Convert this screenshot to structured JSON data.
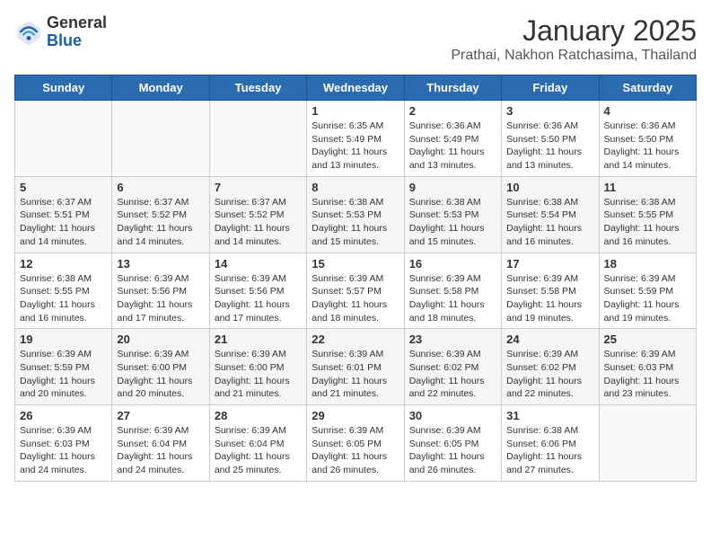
{
  "header": {
    "logo_line1": "General",
    "logo_line2": "Blue",
    "title": "January 2025",
    "subtitle": "Prathai, Nakhon Ratchasima, Thailand"
  },
  "days_of_week": [
    "Sunday",
    "Monday",
    "Tuesday",
    "Wednesday",
    "Thursday",
    "Friday",
    "Saturday"
  ],
  "weeks": [
    [
      {
        "day": "",
        "sunrise": "",
        "sunset": "",
        "daylight": ""
      },
      {
        "day": "",
        "sunrise": "",
        "sunset": "",
        "daylight": ""
      },
      {
        "day": "",
        "sunrise": "",
        "sunset": "",
        "daylight": ""
      },
      {
        "day": "1",
        "sunrise": "Sunrise: 6:35 AM",
        "sunset": "Sunset: 5:49 PM",
        "daylight": "Daylight: 11 hours and 13 minutes."
      },
      {
        "day": "2",
        "sunrise": "Sunrise: 6:36 AM",
        "sunset": "Sunset: 5:49 PM",
        "daylight": "Daylight: 11 hours and 13 minutes."
      },
      {
        "day": "3",
        "sunrise": "Sunrise: 6:36 AM",
        "sunset": "Sunset: 5:50 PM",
        "daylight": "Daylight: 11 hours and 13 minutes."
      },
      {
        "day": "4",
        "sunrise": "Sunrise: 6:36 AM",
        "sunset": "Sunset: 5:50 PM",
        "daylight": "Daylight: 11 hours and 14 minutes."
      }
    ],
    [
      {
        "day": "5",
        "sunrise": "Sunrise: 6:37 AM",
        "sunset": "Sunset: 5:51 PM",
        "daylight": "Daylight: 11 hours and 14 minutes."
      },
      {
        "day": "6",
        "sunrise": "Sunrise: 6:37 AM",
        "sunset": "Sunset: 5:52 PM",
        "daylight": "Daylight: 11 hours and 14 minutes."
      },
      {
        "day": "7",
        "sunrise": "Sunrise: 6:37 AM",
        "sunset": "Sunset: 5:52 PM",
        "daylight": "Daylight: 11 hours and 14 minutes."
      },
      {
        "day": "8",
        "sunrise": "Sunrise: 6:38 AM",
        "sunset": "Sunset: 5:53 PM",
        "daylight": "Daylight: 11 hours and 15 minutes."
      },
      {
        "day": "9",
        "sunrise": "Sunrise: 6:38 AM",
        "sunset": "Sunset: 5:53 PM",
        "daylight": "Daylight: 11 hours and 15 minutes."
      },
      {
        "day": "10",
        "sunrise": "Sunrise: 6:38 AM",
        "sunset": "Sunset: 5:54 PM",
        "daylight": "Daylight: 11 hours and 16 minutes."
      },
      {
        "day": "11",
        "sunrise": "Sunrise: 6:38 AM",
        "sunset": "Sunset: 5:55 PM",
        "daylight": "Daylight: 11 hours and 16 minutes."
      }
    ],
    [
      {
        "day": "12",
        "sunrise": "Sunrise: 6:38 AM",
        "sunset": "Sunset: 5:55 PM",
        "daylight": "Daylight: 11 hours and 16 minutes."
      },
      {
        "day": "13",
        "sunrise": "Sunrise: 6:39 AM",
        "sunset": "Sunset: 5:56 PM",
        "daylight": "Daylight: 11 hours and 17 minutes."
      },
      {
        "day": "14",
        "sunrise": "Sunrise: 6:39 AM",
        "sunset": "Sunset: 5:56 PM",
        "daylight": "Daylight: 11 hours and 17 minutes."
      },
      {
        "day": "15",
        "sunrise": "Sunrise: 6:39 AM",
        "sunset": "Sunset: 5:57 PM",
        "daylight": "Daylight: 11 hours and 18 minutes."
      },
      {
        "day": "16",
        "sunrise": "Sunrise: 6:39 AM",
        "sunset": "Sunset: 5:58 PM",
        "daylight": "Daylight: 11 hours and 18 minutes."
      },
      {
        "day": "17",
        "sunrise": "Sunrise: 6:39 AM",
        "sunset": "Sunset: 5:58 PM",
        "daylight": "Daylight: 11 hours and 19 minutes."
      },
      {
        "day": "18",
        "sunrise": "Sunrise: 6:39 AM",
        "sunset": "Sunset: 5:59 PM",
        "daylight": "Daylight: 11 hours and 19 minutes."
      }
    ],
    [
      {
        "day": "19",
        "sunrise": "Sunrise: 6:39 AM",
        "sunset": "Sunset: 5:59 PM",
        "daylight": "Daylight: 11 hours and 20 minutes."
      },
      {
        "day": "20",
        "sunrise": "Sunrise: 6:39 AM",
        "sunset": "Sunset: 6:00 PM",
        "daylight": "Daylight: 11 hours and 20 minutes."
      },
      {
        "day": "21",
        "sunrise": "Sunrise: 6:39 AM",
        "sunset": "Sunset: 6:00 PM",
        "daylight": "Daylight: 11 hours and 21 minutes."
      },
      {
        "day": "22",
        "sunrise": "Sunrise: 6:39 AM",
        "sunset": "Sunset: 6:01 PM",
        "daylight": "Daylight: 11 hours and 21 minutes."
      },
      {
        "day": "23",
        "sunrise": "Sunrise: 6:39 AM",
        "sunset": "Sunset: 6:02 PM",
        "daylight": "Daylight: 11 hours and 22 minutes."
      },
      {
        "day": "24",
        "sunrise": "Sunrise: 6:39 AM",
        "sunset": "Sunset: 6:02 PM",
        "daylight": "Daylight: 11 hours and 22 minutes."
      },
      {
        "day": "25",
        "sunrise": "Sunrise: 6:39 AM",
        "sunset": "Sunset: 6:03 PM",
        "daylight": "Daylight: 11 hours and 23 minutes."
      }
    ],
    [
      {
        "day": "26",
        "sunrise": "Sunrise: 6:39 AM",
        "sunset": "Sunset: 6:03 PM",
        "daylight": "Daylight: 11 hours and 24 minutes."
      },
      {
        "day": "27",
        "sunrise": "Sunrise: 6:39 AM",
        "sunset": "Sunset: 6:04 PM",
        "daylight": "Daylight: 11 hours and 24 minutes."
      },
      {
        "day": "28",
        "sunrise": "Sunrise: 6:39 AM",
        "sunset": "Sunset: 6:04 PM",
        "daylight": "Daylight: 11 hours and 25 minutes."
      },
      {
        "day": "29",
        "sunrise": "Sunrise: 6:39 AM",
        "sunset": "Sunset: 6:05 PM",
        "daylight": "Daylight: 11 hours and 26 minutes."
      },
      {
        "day": "30",
        "sunrise": "Sunrise: 6:39 AM",
        "sunset": "Sunset: 6:05 PM",
        "daylight": "Daylight: 11 hours and 26 minutes."
      },
      {
        "day": "31",
        "sunrise": "Sunrise: 6:38 AM",
        "sunset": "Sunset: 6:06 PM",
        "daylight": "Daylight: 11 hours and 27 minutes."
      },
      {
        "day": "",
        "sunrise": "",
        "sunset": "",
        "daylight": ""
      }
    ]
  ]
}
